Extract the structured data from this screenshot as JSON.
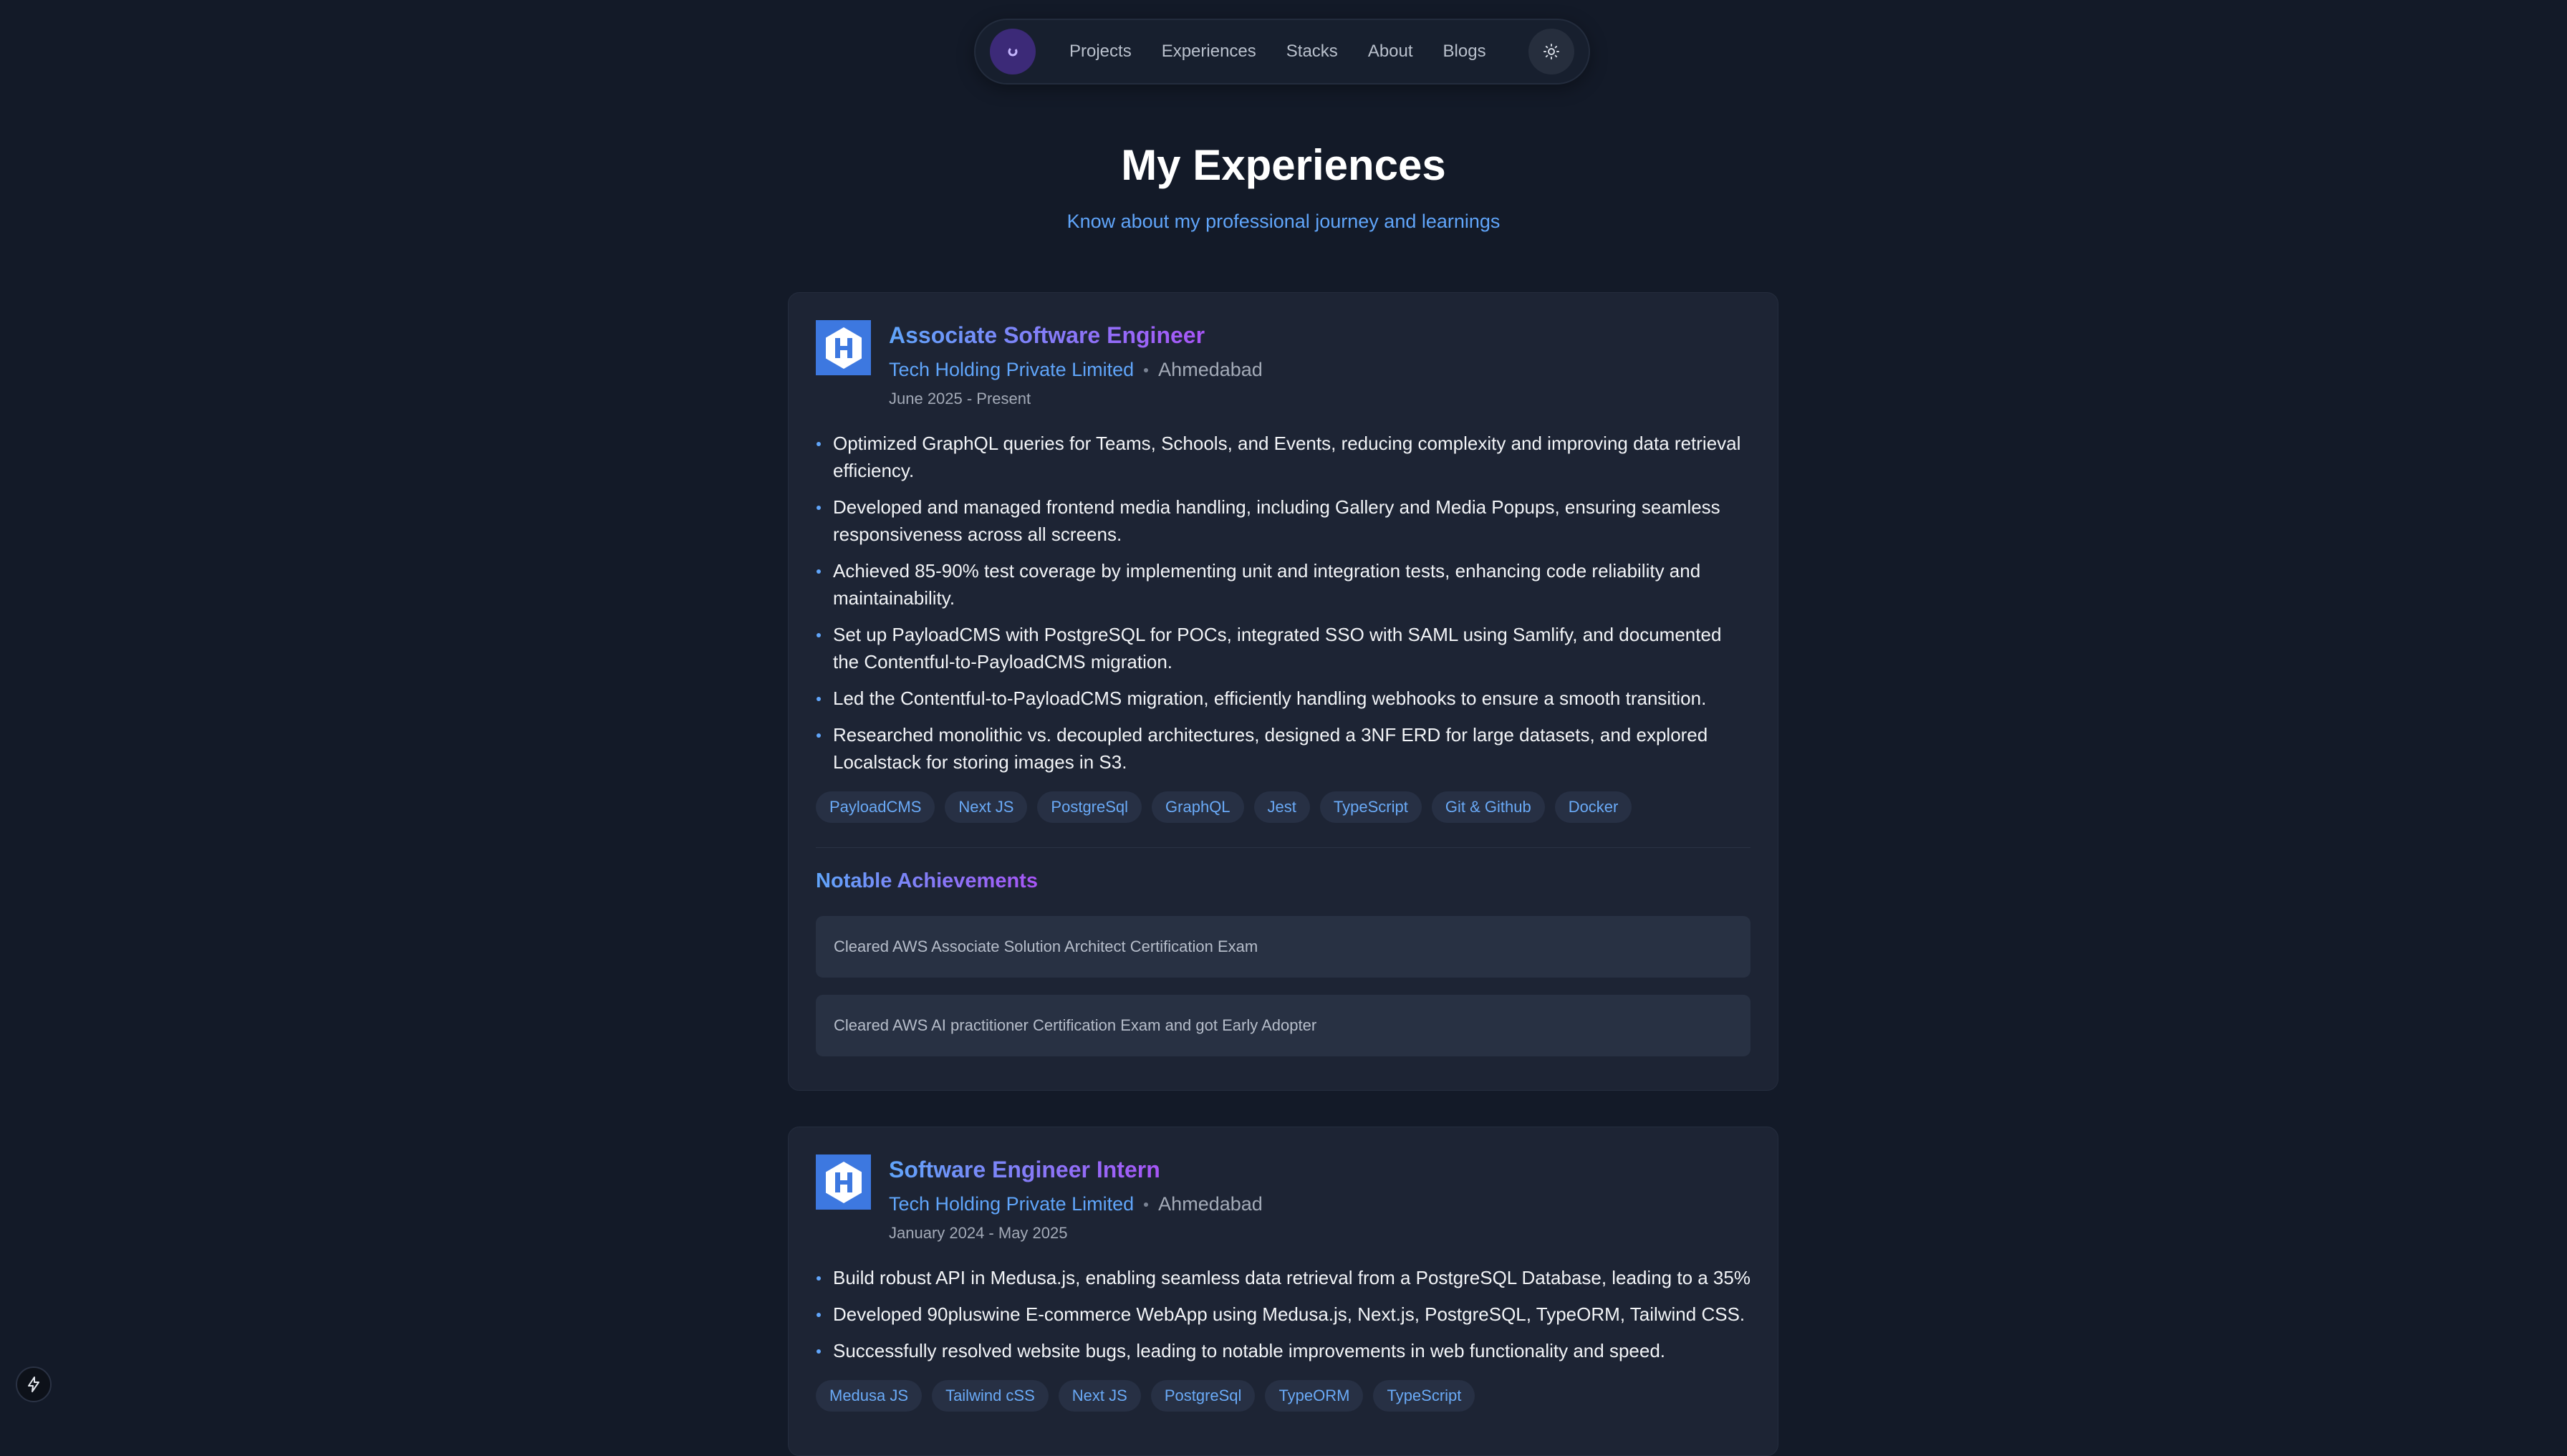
{
  "nav": {
    "links": [
      "Projects",
      "Experiences",
      "Stacks",
      "About",
      "Blogs"
    ]
  },
  "header": {
    "title": "My Experiences",
    "subtitle": "Know about my professional journey and learnings"
  },
  "experiences": [
    {
      "role": "Associate Software Engineer",
      "company": "Tech Holding Private Limited",
      "location": "Ahmedabad",
      "dates": "June 2025 - Present",
      "bullets": [
        "Optimized GraphQL queries for Teams, Schools, and Events, reducing complexity and improving data retrieval efficiency.",
        "Developed and managed frontend media handling, including Gallery and Media Popups, ensuring seamless responsiveness across all screens.",
        "Achieved 85-90% test coverage by implementing unit and integration tests, enhancing code reliability and maintainability.",
        "Set up PayloadCMS with PostgreSQL for POCs, integrated SSO with SAML using Samlify, and documented the Contentful-to-PayloadCMS migration.",
        "Led the Contentful-to-PayloadCMS migration, efficiently handling webhooks to ensure a smooth transition.",
        "Researched monolithic vs. decoupled architectures, designed a 3NF ERD for large datasets, and explored Localstack for storing images in S3."
      ],
      "tags": [
        "PayloadCMS",
        "Next JS",
        "PostgreSql",
        "GraphQL",
        "Jest",
        "TypeScript",
        "Git & Github",
        "Docker"
      ],
      "achievements_title": "Notable Achievements",
      "achievements": [
        "Cleared AWS Associate Solution Architect Certification Exam",
        "Cleared AWS AI practitioner Certification Exam and got Early Adopter"
      ]
    },
    {
      "role": "Software Engineer Intern",
      "company": "Tech Holding Private Limited",
      "location": "Ahmedabad",
      "dates": "January 2024 - May 2025",
      "bullets": [
        "Build robust API in Medusa.js, enabling seamless data retrieval from a PostgreSQL Database, leading to a 35%",
        "Developed 90pluswine E-commerce WebApp using Medusa.js, Next.js, PostgreSQL, TypeORM, Tailwind CSS.",
        "Successfully resolved website bugs, leading to notable improvements in web functionality and speed."
      ],
      "tags": [
        "Medusa JS",
        "Tailwind cSS",
        "Next JS",
        "PostgreSql",
        "TypeORM",
        "TypeScript"
      ]
    }
  ],
  "icons": {
    "nav_logo": "logo-icon",
    "theme_toggle": "sun-icon",
    "company_logo": "hexagon-h-icon",
    "corner_badge": "lightning-icon"
  },
  "colors": {
    "background": "#131a28",
    "card": "#1d2434",
    "accent_blue": "#60a5fa",
    "accent_purple": "#a855f7"
  }
}
